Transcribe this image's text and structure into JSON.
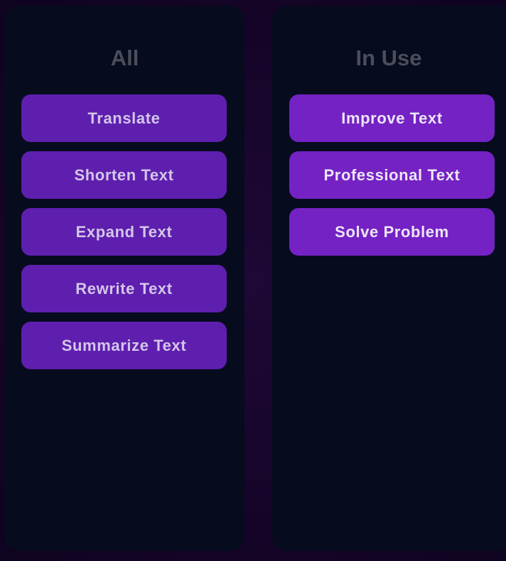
{
  "columns": {
    "all": {
      "title": "All",
      "items": [
        {
          "label": "Translate"
        },
        {
          "label": "Shorten Text"
        },
        {
          "label": "Expand Text"
        },
        {
          "label": "Rewrite Text"
        },
        {
          "label": "Summarize Text"
        }
      ]
    },
    "in_use": {
      "title": "In Use",
      "items": [
        {
          "label": "Improve Text"
        },
        {
          "label": "Professional Text"
        },
        {
          "label": "Solve Problem"
        }
      ]
    }
  },
  "colors": {
    "background": "#160428",
    "panel": "#060b1e",
    "title_text": "#4b4e5a",
    "chip_all": "#5e1fae",
    "chip_in_use": "#7422c4"
  }
}
